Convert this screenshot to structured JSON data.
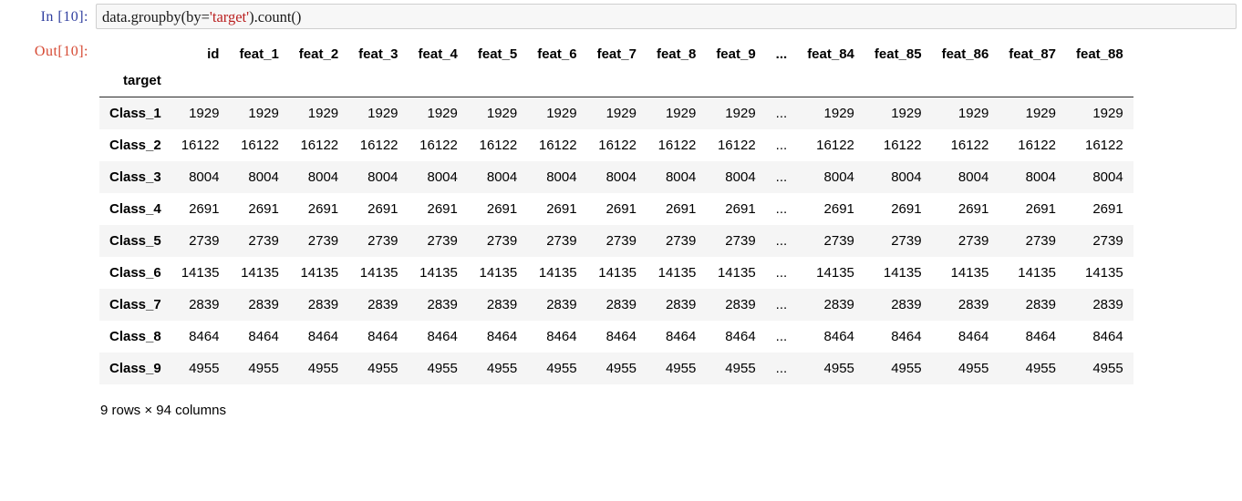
{
  "cell": {
    "input_prompt": "In  [10]:",
    "output_prompt": "Out[10]:",
    "code": {
      "part1": "data.groupby(by=",
      "string": "'target'",
      "part3": ").count()"
    },
    "code_full": "data.groupby(by='target').count()"
  },
  "colors": {
    "input_prompt": "#303F9F",
    "output_prompt": "#D64933",
    "string_token": "#BA2121",
    "operator_token": "#6a3fa0",
    "row_stripe": "#f5f5f5",
    "input_bg": "#f7f7f7",
    "header_rule": "#2b2b2b"
  },
  "table": {
    "index_name": "target",
    "columns": [
      "id",
      "feat_1",
      "feat_2",
      "feat_3",
      "feat_4",
      "feat_5",
      "feat_6",
      "feat_7",
      "feat_8",
      "feat_9",
      "...",
      "feat_84",
      "feat_85",
      "feat_86",
      "feat_87",
      "feat_88"
    ],
    "rows": [
      {
        "index": "Class_1",
        "values": [
          "1929",
          "1929",
          "1929",
          "1929",
          "1929",
          "1929",
          "1929",
          "1929",
          "1929",
          "1929",
          "...",
          "1929",
          "1929",
          "1929",
          "1929",
          "1929"
        ]
      },
      {
        "index": "Class_2",
        "values": [
          "16122",
          "16122",
          "16122",
          "16122",
          "16122",
          "16122",
          "16122",
          "16122",
          "16122",
          "16122",
          "...",
          "16122",
          "16122",
          "16122",
          "16122",
          "16122"
        ]
      },
      {
        "index": "Class_3",
        "values": [
          "8004",
          "8004",
          "8004",
          "8004",
          "8004",
          "8004",
          "8004",
          "8004",
          "8004",
          "8004",
          "...",
          "8004",
          "8004",
          "8004",
          "8004",
          "8004"
        ]
      },
      {
        "index": "Class_4",
        "values": [
          "2691",
          "2691",
          "2691",
          "2691",
          "2691",
          "2691",
          "2691",
          "2691",
          "2691",
          "2691",
          "...",
          "2691",
          "2691",
          "2691",
          "2691",
          "2691"
        ]
      },
      {
        "index": "Class_5",
        "values": [
          "2739",
          "2739",
          "2739",
          "2739",
          "2739",
          "2739",
          "2739",
          "2739",
          "2739",
          "2739",
          "...",
          "2739",
          "2739",
          "2739",
          "2739",
          "2739"
        ]
      },
      {
        "index": "Class_6",
        "values": [
          "14135",
          "14135",
          "14135",
          "14135",
          "14135",
          "14135",
          "14135",
          "14135",
          "14135",
          "14135",
          "...",
          "14135",
          "14135",
          "14135",
          "14135",
          "14135"
        ]
      },
      {
        "index": "Class_7",
        "values": [
          "2839",
          "2839",
          "2839",
          "2839",
          "2839",
          "2839",
          "2839",
          "2839",
          "2839",
          "2839",
          "...",
          "2839",
          "2839",
          "2839",
          "2839",
          "2839"
        ]
      },
      {
        "index": "Class_8",
        "values": [
          "8464",
          "8464",
          "8464",
          "8464",
          "8464",
          "8464",
          "8464",
          "8464",
          "8464",
          "8464",
          "...",
          "8464",
          "8464",
          "8464",
          "8464",
          "8464"
        ]
      },
      {
        "index": "Class_9",
        "values": [
          "4955",
          "4955",
          "4955",
          "4955",
          "4955",
          "4955",
          "4955",
          "4955",
          "4955",
          "4955",
          "...",
          "4955",
          "4955",
          "4955",
          "4955",
          "4955"
        ]
      }
    ],
    "shape_caption": "9 rows × 94 columns"
  }
}
